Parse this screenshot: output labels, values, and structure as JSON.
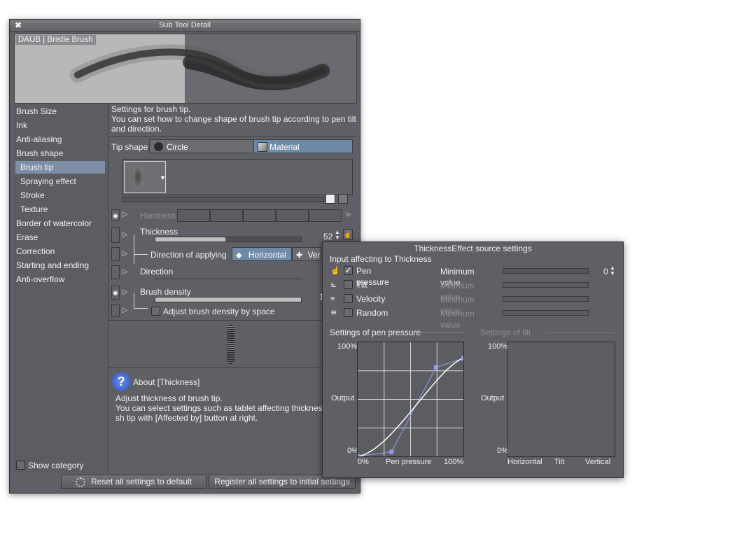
{
  "window": {
    "title": "Sub Tool Detail",
    "preview_label": "DAUB | Bristle Brush"
  },
  "sidebar": {
    "items": [
      {
        "label": "Brush Size",
        "level": 0,
        "selected": false
      },
      {
        "label": "Ink",
        "level": 0,
        "selected": false
      },
      {
        "label": "Anti-aliasing",
        "level": 0,
        "selected": false
      },
      {
        "label": "Brush shape",
        "level": 0,
        "selected": false
      },
      {
        "label": "Brush tip",
        "level": 1,
        "selected": true
      },
      {
        "label": "Spraying effect",
        "level": 1,
        "selected": false
      },
      {
        "label": "Stroke",
        "level": 1,
        "selected": false
      },
      {
        "label": "Texture",
        "level": 1,
        "selected": false
      },
      {
        "label": "Border of watercolor",
        "level": 0,
        "selected": false
      },
      {
        "label": "Erase",
        "level": 0,
        "selected": false
      },
      {
        "label": "Correction",
        "level": 0,
        "selected": false
      },
      {
        "label": "Starting and ending",
        "level": 0,
        "selected": false
      },
      {
        "label": "Anti-overflow",
        "level": 0,
        "selected": false
      }
    ],
    "show_category": "Show category"
  },
  "main": {
    "desc_line1": "Settings for brush tip.",
    "desc_line2": "You can set how to change shape of brush tip according to pen tilt and direction.",
    "tip_shape_label": "Tip shape",
    "tip_circle": "Circle",
    "tip_material": "Material",
    "hardness_label": "Hardness",
    "thickness_label": "Thickness",
    "thickness_value": "52",
    "thickness_fill": 0.48,
    "direction_applying_label": "Direction of applying",
    "dir_horizontal": "Horizontal",
    "dir_vertical": "Ver",
    "direction_label": "Direction",
    "density_label": "Brush density",
    "density_value": "1",
    "density_fill": 1.0,
    "adjust_density_label": "Adjust brush density by space"
  },
  "help": {
    "title": "About [Thickness]",
    "line1": "Adjust thickness of brush tip.",
    "line2": "You can select settings such as tablet affecting thickness",
    "line3": "sh tip with [Affected by] button at right."
  },
  "footer": {
    "reset_label": "Reset all settings to default",
    "register_label": "Register all settings to initial settings"
  },
  "popup": {
    "title": "ThicknessEffect source settings",
    "section_label": "Input affecting to Thickness",
    "inputs": [
      {
        "label": "Pen pressure",
        "checked": true,
        "min_label": "Minimum value",
        "min_value": "0",
        "enabled": true
      },
      {
        "label": "Tilt",
        "checked": false,
        "min_label": "Minimum value",
        "enabled": false
      },
      {
        "label": "Velocity",
        "checked": false,
        "min_label": "Minimum value",
        "enabled": false
      },
      {
        "label": "Random",
        "checked": false,
        "min_label": "Minimum value",
        "enabled": false
      }
    ],
    "pressure_section": "Settings of pen pressure",
    "tilt_section": "Settings of tilt",
    "pressure_graph": {
      "y_top": "100%",
      "y_mid": "Output",
      "y_bottom": "0%",
      "x_left": "0%",
      "x_mid": "Pen pressure",
      "x_right": "100%",
      "points": [
        [
          0,
          0
        ],
        [
          0.32,
          0.04
        ],
        [
          0.74,
          0.78
        ],
        [
          1.0,
          0.86
        ]
      ]
    },
    "tilt_graph": {
      "y_top": "100%",
      "y_mid": "Output",
      "y_bottom": "0%",
      "x_left": "Horizontal",
      "x_mid": "Tilt",
      "x_right": "Vertical"
    }
  }
}
